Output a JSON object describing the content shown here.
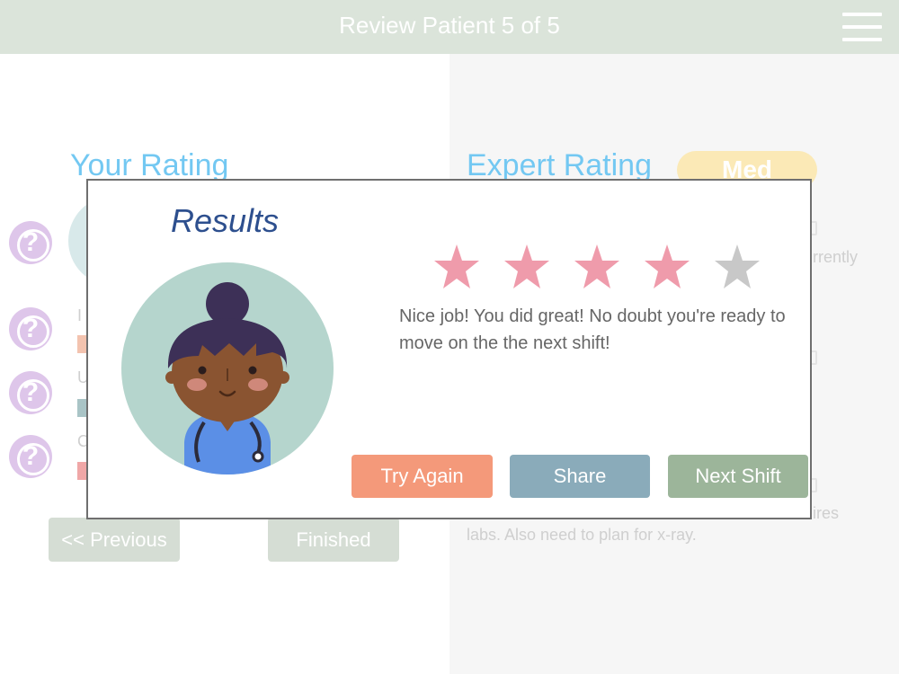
{
  "header": {
    "title": "Review Patient 5 of 5",
    "menu_icon": "hamburger-menu-icon"
  },
  "left": {
    "section_title": "Your Rating",
    "help_icon_glyph": "?",
    "rows": [
      {
        "letter": "I",
        "bar_color": "#f3c3af"
      },
      {
        "letter": "U",
        "bar_color": "#a9c4c6"
      },
      {
        "letter": "C",
        "bar_color": "#f0a7a7"
      }
    ],
    "previous_label": "<< Previous",
    "finished_label": "Finished"
  },
  "right": {
    "section_title": "Expert Rating",
    "badge": "Med",
    "text_fragment_1": "rrently",
    "text_fragment_2": "ires",
    "text_fragment_3": "labs. Also need to plan for x-ray."
  },
  "modal": {
    "title": "Results",
    "rating": {
      "value": 4,
      "max": 5
    },
    "colors": {
      "star_filled": "#ef9bab",
      "star_empty": "#c8c8c8"
    },
    "message": "Nice job! You did great! No doubt you're ready to move on the the next shift!",
    "buttons": {
      "try_again": {
        "label": "Try Again",
        "color": "#f4997a"
      },
      "share": {
        "label": "Share",
        "color": "#8aabba"
      },
      "next_shift": {
        "label": "Next Shift",
        "color": "#9cb59a"
      }
    }
  }
}
